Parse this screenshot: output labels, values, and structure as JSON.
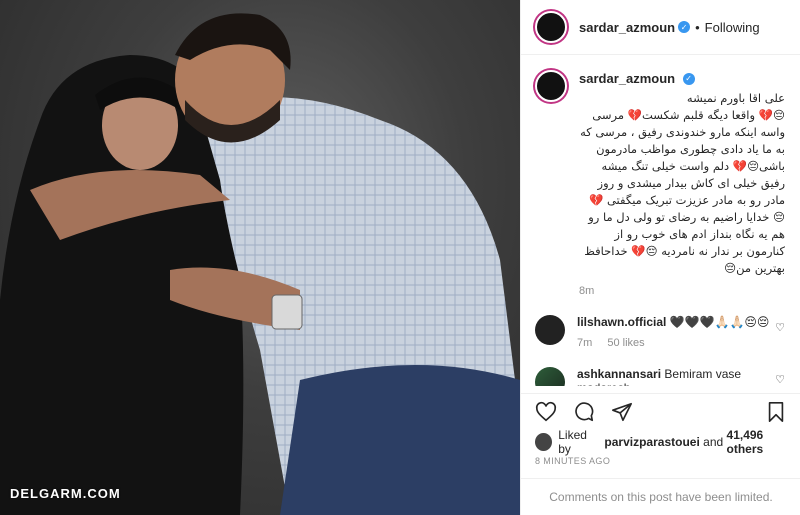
{
  "photo": {
    "watermark": "DELGARM.COM"
  },
  "post": {
    "author": "sardar_azmoun",
    "follow_label": "Following",
    "caption_user": "sardar_azmoun",
    "caption": "علی اقا باورم نمیشه\n😔💔 واقعا دیگه قلبم شکست💔 مرسی\nواسه اینکه مارو خندوندی رفیق ، مرسی که\nبه ما یاد دادی چطوری مواظب مادرمون\nباشی😔💔 دلم واست خیلی تنگ میشه\nرفیق خیلی ای کاش بیدار میشدی و روز\nمادر رو به مادر عزیزت تبریک میگفتی 💔\n😔 خدایا راضیم به رضای تو ولی دل ما رو\nهم یه نگاه بنداز ادم های خوب رو از\nکنارمون بر ندار نه نامردیه 😔💔 خداحافظ\nبهترین من😔",
    "caption_time": "8m",
    "comments": [
      {
        "user": "lilshawn.official",
        "text": "🖤🖤🖤🙏🏻🙏🏻😔😔",
        "time": "7m",
        "likes": "50 likes"
      },
      {
        "user": "ashkannansari",
        "text": "Bemiram vase madaresh"
      }
    ],
    "liked_prefix": "Liked by",
    "liked_user": "parvizparastouei",
    "liked_and": "and",
    "liked_count": "41,496 others",
    "time_ago": "8 MINUTES AGO",
    "comments_disabled": "Comments on this post have been limited."
  },
  "icons": [
    "heart-icon",
    "comment-icon",
    "share-icon",
    "bookmark-icon",
    "verified-icon",
    "small-heart-icon"
  ],
  "colors": {
    "verified": "#3897f0",
    "muted": "#8e8e8e",
    "text": "#262626"
  }
}
